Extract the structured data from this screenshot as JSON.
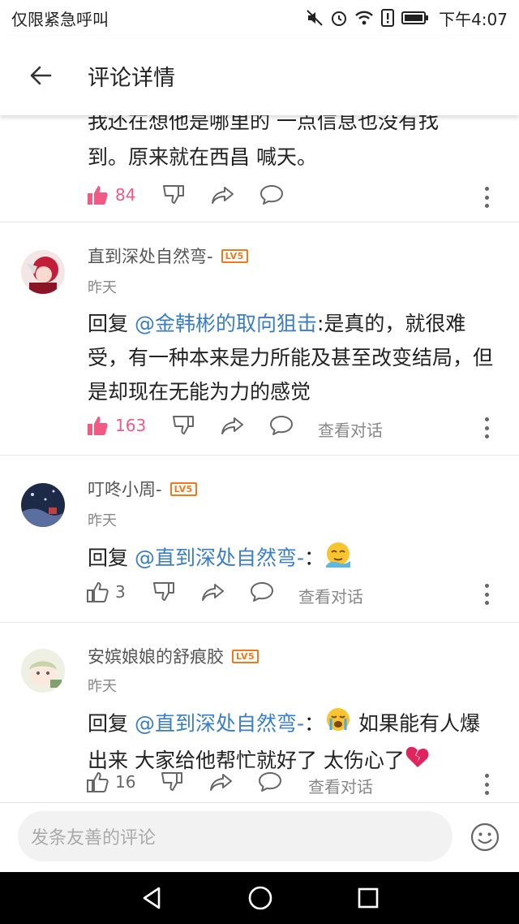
{
  "status_bar": {
    "carrier": "仅限紧急呼叫",
    "time": "下午4:07"
  },
  "header": {
    "title": "评论详情",
    "back_icon": "arrow-left-icon"
  },
  "comments": [
    {
      "text_lines": [
        "我还在想他是哪里的 一点信息也没有找",
        "到。原来就在西昌 喊天。"
      ],
      "likes": "84",
      "liked": true
    },
    {
      "username": "直到深处自然弯-",
      "level": "LV5",
      "time": "昨天",
      "reply_prefix": "回复 ",
      "mention": "@金韩彬的取向狙击",
      "text": ":是真的，就很难受，有一种本来是力所能及甚至改变结局，但是却现在无能为力的感觉",
      "likes": "163",
      "liked": true,
      "view_dialog": "查看对话"
    },
    {
      "username": "叮咚小周-",
      "level": "LV5",
      "time": "昨天",
      "reply_prefix": "回复 ",
      "mention": "@直到深处自然弯-",
      "text": "：",
      "emoji": "relieved-face-emoji",
      "likes": "3",
      "liked": false,
      "view_dialog": "查看对话"
    },
    {
      "username": "安嫔娘娘的舒痕胶",
      "level": "LV5",
      "time": "昨天",
      "reply_prefix": "回复 ",
      "mention": "@直到深处自然弯-",
      "text_a": "：",
      "text_b": " 如果能有人爆出来 大家给他帮忙就好了 太伤心了",
      "emoji_a": "crying-face-emoji",
      "emoji_b": "broken-heart-emoji",
      "likes": "16",
      "liked": false,
      "view_dialog": "查看对话"
    }
  ],
  "input_bar": {
    "placeholder": "发条友善的评论",
    "emoji_button": "smiley-icon"
  },
  "colors": {
    "like_active": "#ef5b85",
    "mention": "#3a7ec4",
    "level_badge": "#f07a1a"
  }
}
